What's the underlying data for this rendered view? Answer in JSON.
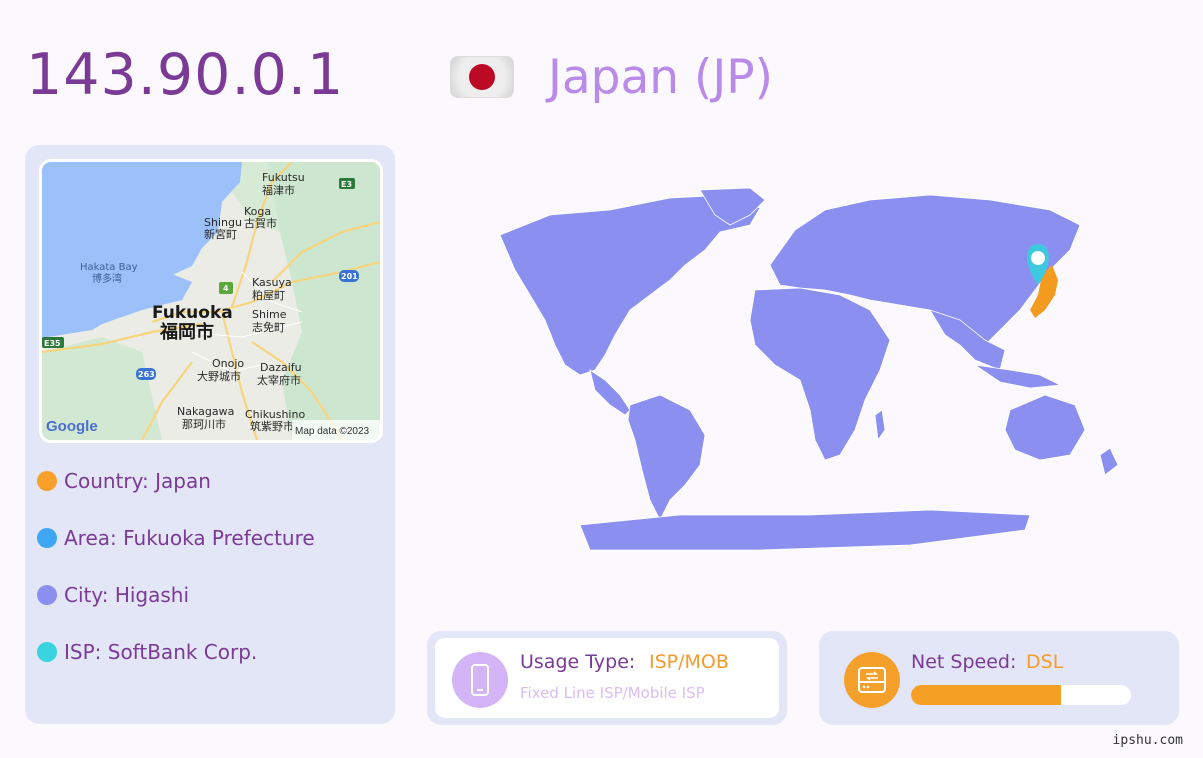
{
  "header": {
    "ip": "143.90.0.1",
    "country_title": "Japan (JP)",
    "flag_icon": "japan-flag-icon"
  },
  "map": {
    "labels": {
      "bay_en": "Hakata Bay",
      "bay_jp": "博多湾",
      "city_en": "Fukuoka",
      "city_jp": "福岡市",
      "fukutsu_en": "Fukutsu",
      "fukutsu_jp": "福津市",
      "koga_en": "Koga",
      "koga_jp": "古賀市",
      "shingu_en": "Shingu",
      "shingu_jp": "新宮町",
      "kasuya_en": "Kasuya",
      "kasuya_jp": "粕屋町",
      "shime_en": "Shime",
      "shime_jp": "志免町",
      "onojo_en": "Onojo",
      "onojo_jp": "大野城市",
      "dazaifu_en": "Dazaifu",
      "dazaifu_jp": "太宰府市",
      "nakagawa_en": "Nakagawa",
      "nakagawa_jp": "那珂川市",
      "chikushino_en": "Chikushino",
      "chikushino_jp": "筑紫野市",
      "route_e3": "E3",
      "route_e35": "E35",
      "route_4": "4",
      "route_201": "201",
      "route_263": "263",
      "google": "Google",
      "attribution": "Map data ©2023"
    }
  },
  "info": {
    "country": "Country: Japan",
    "area": "Area: Fukuoka Prefecture",
    "city": "City: Higashi",
    "isp": "ISP: SoftBank Corp."
  },
  "colors": {
    "country_dot": "#f7a02b",
    "area_dot": "#3ea6f3",
    "city_dot": "#8a8ff0",
    "isp_dot": "#39d4e0",
    "continents": "#8a8ff0",
    "highlight": "#f39b1e",
    "marker": "#3ec9df"
  },
  "usage": {
    "label": "Usage Type:",
    "value": "ISP/MOB",
    "sub": "Fixed Line ISP/Mobile ISP",
    "icon": "mobile-phone-icon"
  },
  "speed": {
    "label": "Net Speed:",
    "value": "DSL",
    "icon": "hard-drive-icon",
    "fill_fraction": 0.68
  },
  "footer": {
    "watermark": "ipshu.com"
  }
}
